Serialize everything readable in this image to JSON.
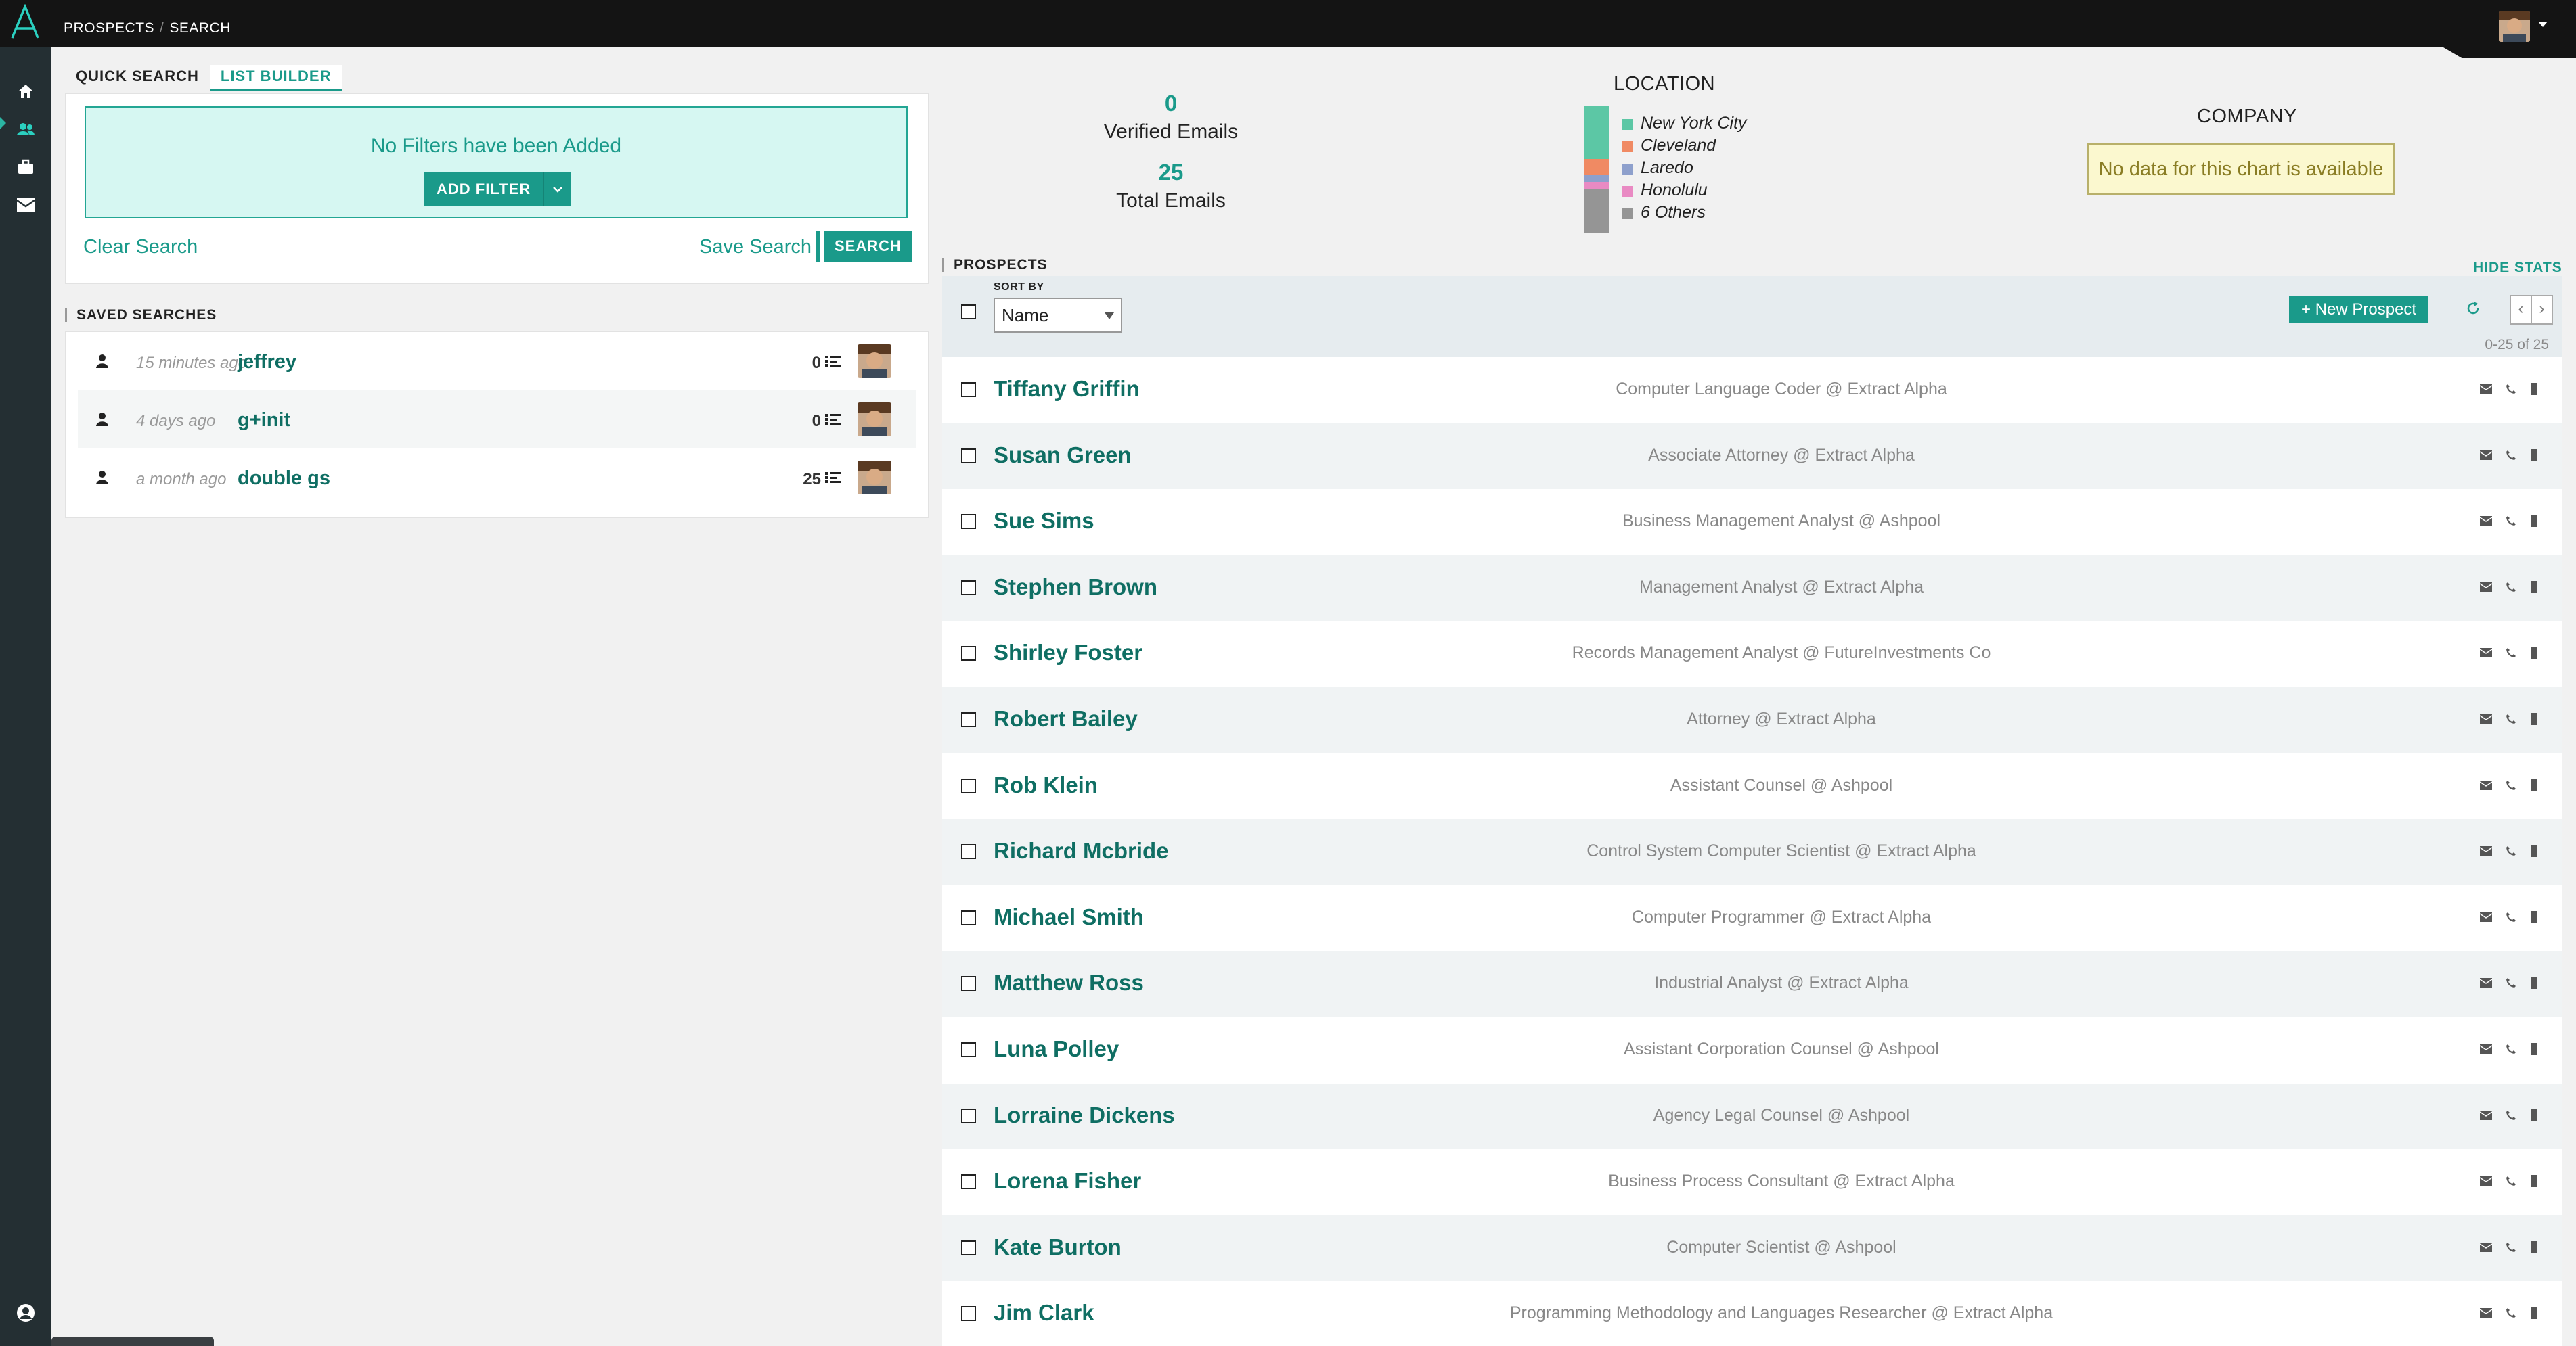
{
  "breadcrumb": {
    "first": "PROSPECTS",
    "second": "SEARCH"
  },
  "tabs": {
    "quick": "QUICK SEARCH",
    "list": "LIST BUILDER"
  },
  "filters": {
    "empty_text": "No Filters have been Added",
    "add_label": "ADD FILTER"
  },
  "search_actions": {
    "clear": "Clear Search",
    "save": "Save Search",
    "search": "SEARCH"
  },
  "saved": {
    "title": "SAVED SEARCHES",
    "items": [
      {
        "time": "15 minutes ago",
        "name": "jeffrey",
        "count": "0"
      },
      {
        "time": "4 days ago",
        "name": "g+init",
        "count": "0"
      },
      {
        "time": "a month ago",
        "name": "double gs",
        "count": "25"
      }
    ]
  },
  "stats": {
    "verified_count": "0",
    "verified_label": "Verified Emails",
    "total_count": "25",
    "total_label": "Total Emails",
    "hide_label": "HIDE STATS"
  },
  "location": {
    "title": "LOCATION",
    "items": [
      {
        "label": "New York City",
        "color": "#5cc7a5",
        "share": 0.42
      },
      {
        "label": "Cleveland",
        "color": "#f08a63",
        "share": 0.12
      },
      {
        "label": "Laredo",
        "color": "#8ea0cc",
        "share": 0.06
      },
      {
        "label": "Honolulu",
        "color": "#e98ac3",
        "share": 0.06
      },
      {
        "label": "6 Others",
        "color": "#959595",
        "share": 0.34
      }
    ]
  },
  "company": {
    "title": "COMPANY",
    "no_data": "No data for this chart is available"
  },
  "prospects": {
    "title": "PROSPECTS",
    "sort_label": "SORT BY",
    "sort_value": "Name",
    "new_label": "New Prospect",
    "range": "0-25 of 25",
    "items": [
      {
        "name": "Tiffany Griffin",
        "title": "Computer Language Coder @ Extract Alpha"
      },
      {
        "name": "Susan Green",
        "title": "Associate Attorney @ Extract Alpha"
      },
      {
        "name": "Sue Sims",
        "title": "Business Management Analyst @ Ashpool"
      },
      {
        "name": "Stephen Brown",
        "title": "Management Analyst @ Extract Alpha"
      },
      {
        "name": "Shirley Foster",
        "title": "Records Management Analyst @ FutureInvestments Co"
      },
      {
        "name": "Robert Bailey",
        "title": "Attorney @ Extract Alpha"
      },
      {
        "name": "Rob Klein",
        "title": "Assistant Counsel @ Ashpool"
      },
      {
        "name": "Richard Mcbride",
        "title": "Control System Computer Scientist @ Extract Alpha"
      },
      {
        "name": "Michael Smith",
        "title": "Computer Programmer @ Extract Alpha"
      },
      {
        "name": "Matthew Ross",
        "title": "Industrial Analyst @ Extract Alpha"
      },
      {
        "name": "Luna Polley",
        "title": "Assistant Corporation Counsel @ Ashpool"
      },
      {
        "name": "Lorraine Dickens",
        "title": "Agency Legal Counsel @ Ashpool"
      },
      {
        "name": "Lorena Fisher",
        "title": "Business Process Consultant @ Extract Alpha"
      },
      {
        "name": "Kate Burton",
        "title": "Computer Scientist @ Ashpool"
      },
      {
        "name": "Jim Clark",
        "title": "Programming Methodology and Languages Researcher @ Extract Alpha"
      }
    ]
  },
  "icons": {
    "nav": [
      "home-icon",
      "people-icon",
      "briefcase-icon",
      "mail-icon",
      "account-icon"
    ],
    "row_actions": [
      "email-icon",
      "phone-icon",
      "mobile-icon"
    ]
  },
  "colors": {
    "accent": "#1a9a8a",
    "topbar": "#141414",
    "sidebar": "#242f33"
  }
}
